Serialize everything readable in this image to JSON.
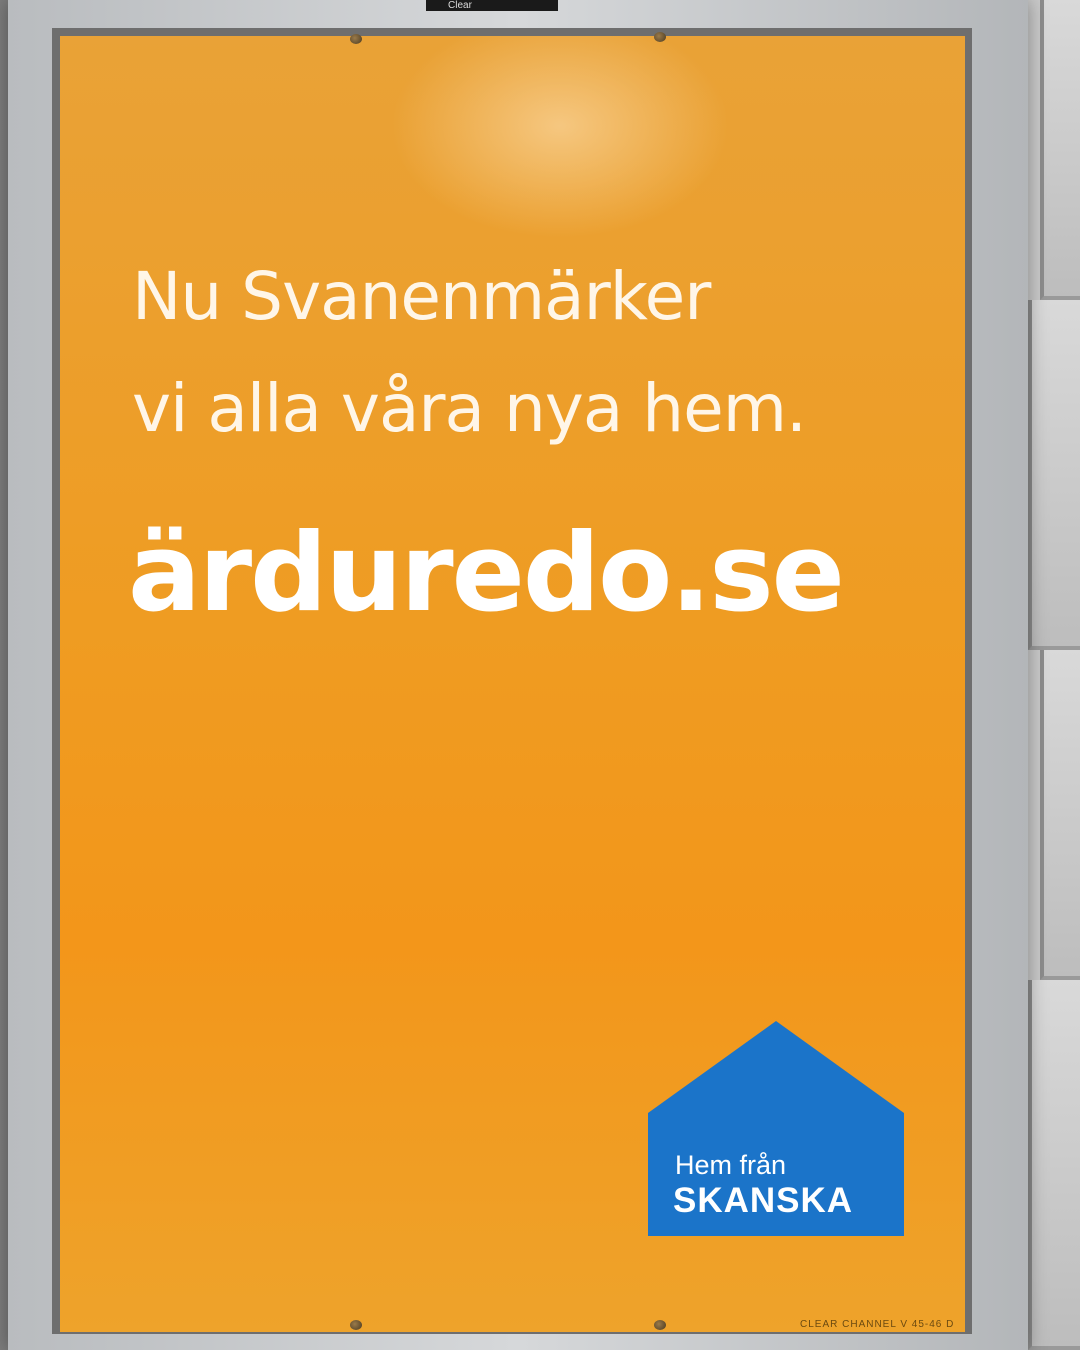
{
  "frame": {
    "top_label": "Clear"
  },
  "poster": {
    "headline_line1": "Nu Svanenmärker",
    "headline_line2": "vi alla våra nya hem.",
    "url": "ärduredo.se",
    "logo": {
      "line1": "Hem från",
      "line2": "SKANSKA",
      "color": "#1a73c8"
    },
    "fine_print": "CLEAR CHANNEL V 45-46 D",
    "background_color": "#f09a1e"
  }
}
